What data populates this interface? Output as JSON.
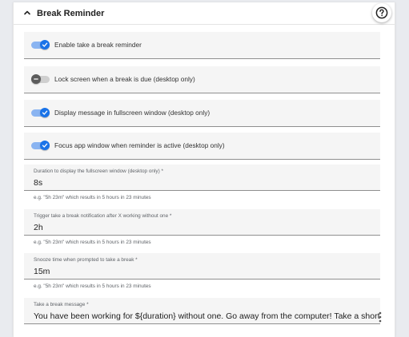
{
  "panel": {
    "title": "Break Reminder",
    "collapse_icon": "chevron-up-icon",
    "help_icon": "question-circle-icon"
  },
  "toggles": [
    {
      "label": "Enable take a break reminder",
      "checked": true
    },
    {
      "label": "Lock screen when a break is due (desktop only)",
      "checked": false
    },
    {
      "label": "Display message in fullscreen window (desktop only)",
      "checked": true
    },
    {
      "label": "Focus app window when reminder is active (desktop only)",
      "checked": true
    }
  ],
  "fields": [
    {
      "label": "Duration to display the fullscreen window (desktop only) *",
      "value": "8s",
      "hint": "e.g. \"5h 23m\" which results in 5 hours in 23 minutes"
    },
    {
      "label": "Trigger take a break notification after X working without one *",
      "value": "2h",
      "hint": "e.g. \"5h 23m\" which results in 5 hours in 23 minutes"
    },
    {
      "label": "Snooze time when prompted to take a break *",
      "value": "15m",
      "hint": "e.g. \"5h 23m\" which results in 5 hours in 23 minutes"
    },
    {
      "label": "Take a break message *",
      "value": "You have been working for ${duration} without one. Go away from the computer! Take a short"
    }
  ],
  "colors": {
    "accent": "#1a73e8",
    "accent_track": "#8ab4f1",
    "off_knob": "#5b5b5b",
    "field_bg": "#f5f5f5"
  }
}
